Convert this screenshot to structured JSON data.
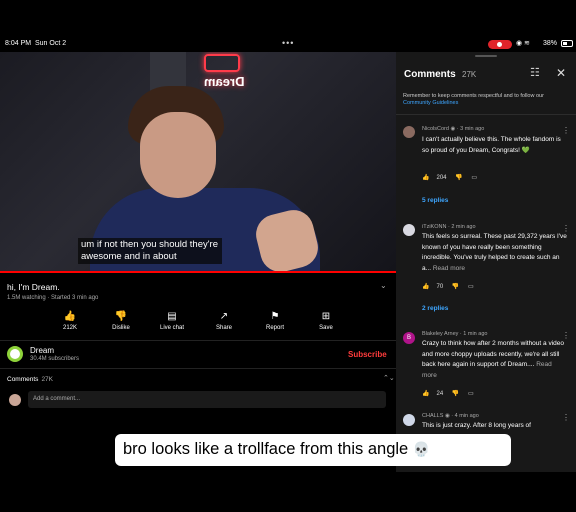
{
  "status_bar": {
    "time": "8:04 PM",
    "date": "Sun Oct 2",
    "battery": "38%",
    "dots": "•••"
  },
  "video": {
    "logo_text": "Dream",
    "caption": "um if not then you should they're awesome and in about",
    "progress_fraction": 1.0,
    "title": "hi, I'm Dream.",
    "meta": "1.5M watching · Started 3 min ago",
    "actions": [
      {
        "label": "212K",
        "icon": "thumbs-up-icon",
        "glyph": "👍"
      },
      {
        "label": "Dislike",
        "icon": "thumbs-down-icon",
        "glyph": "👎"
      },
      {
        "label": "Live chat",
        "icon": "live-chat-icon",
        "glyph": "▤"
      },
      {
        "label": "Share",
        "icon": "share-icon",
        "glyph": "↗"
      },
      {
        "label": "Report",
        "icon": "flag-icon",
        "glyph": "⚑"
      },
      {
        "label": "Save",
        "icon": "save-icon",
        "glyph": "⊞"
      }
    ]
  },
  "channel": {
    "name": "Dream",
    "subscribers": "30.4M subscribers",
    "subscribe_label": "Subscribe",
    "accent": "#ff3c3c"
  },
  "comments_section": {
    "label": "Comments",
    "count": "27K",
    "add_placeholder": "Add a comment..."
  },
  "panel": {
    "title": "Comments",
    "count": "27K",
    "notice": "Remember to keep comments respectful and to follow our",
    "notice_link": "Community Guidelines",
    "comments": [
      {
        "author": "NicolsCord",
        "time": "· 3 min ago",
        "text": "I can't actually believe this. The whole fandom is so proud of you Dream, Congrats! 💚",
        "likes": "204",
        "replies": "5 replies",
        "avatar_color": "#8a6a60"
      },
      {
        "author": "iTziKONN",
        "time": "· 2 min ago",
        "text": "This feels so surreal. These past 29,372 years I've known of you have really been something incredible. You've truly helped to create such an a...",
        "more": "Read more",
        "likes": "70",
        "replies": "2 replies",
        "avatar_color": "#d8d8e0"
      },
      {
        "author": "Blakeley Arney",
        "time": "· 1 min ago",
        "text": "Crazy to think how after 2 months without a video and more choppy uploads recently, we're all still back here again in support of Dream....",
        "more": "Read more",
        "likes": "24",
        "avatar_letter": "B",
        "avatar_color": "#b0138a"
      },
      {
        "author": "CHALLS",
        "time": "· 4 min ago",
        "text": "This is just crazy. After 8 long years of",
        "avatar_color": "#d0d8e8"
      }
    ]
  },
  "overlay": {
    "text": "bro looks like a trollface  from this angle",
    "emoji": "💀"
  }
}
